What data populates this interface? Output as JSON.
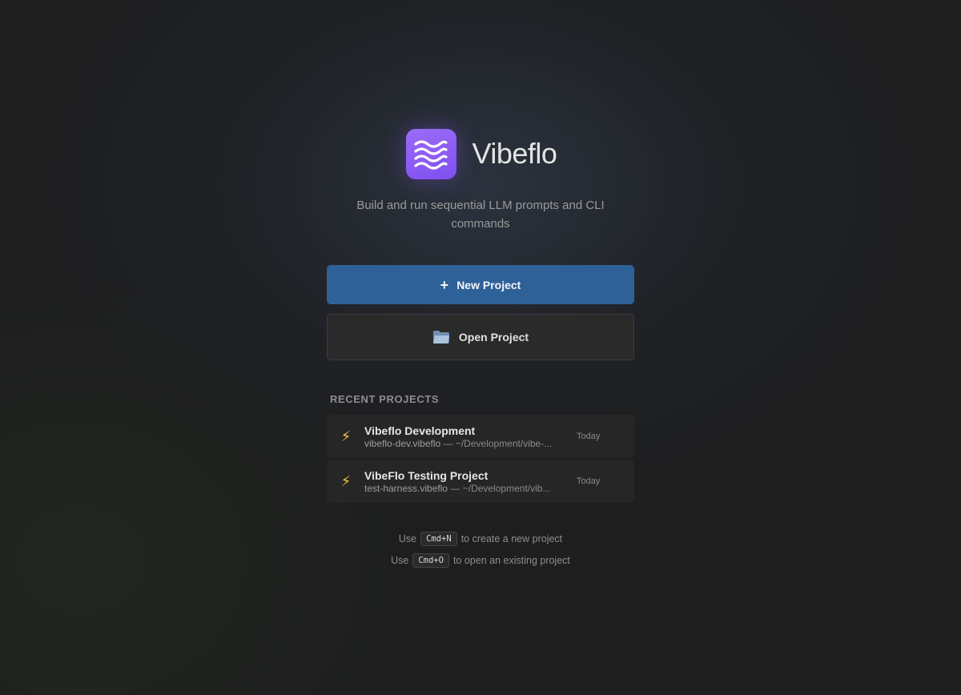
{
  "app": {
    "name": "Vibeflo",
    "tagline": "Build and run sequential LLM prompts and CLI commands",
    "logo_icon": "waves-icon",
    "accent_color": "#8b5cf6"
  },
  "actions": {
    "new_project": {
      "icon": "plus-icon",
      "label": "New Project",
      "color": "#2f6199"
    },
    "open_project": {
      "icon": "folder-icon",
      "label": "Open Project"
    }
  },
  "recent": {
    "heading": "RECENT PROJECTS",
    "items": [
      {
        "icon": "lightning-icon",
        "name": "Vibeflo Development",
        "file": "vibeflo-dev.vibeflo",
        "path": " — ~/Development/vibe-...",
        "date": "Today"
      },
      {
        "icon": "lightning-icon",
        "name": "VibeFlo Testing Project",
        "file": "test-harness.vibeflo",
        "path": " — ~/Development/vib...",
        "date": "Today"
      }
    ]
  },
  "hints": [
    {
      "prefix": "Use",
      "key": "Cmd+N",
      "suffix": "to create a new project"
    },
    {
      "prefix": "Use",
      "key": "Cmd+O",
      "suffix": "to open an existing project"
    }
  ]
}
